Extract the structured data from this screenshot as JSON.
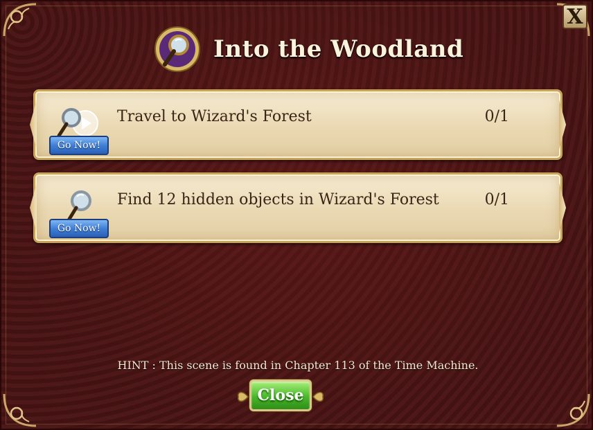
{
  "dialog": {
    "title": "Into the Woodland",
    "close_x_label": "X"
  },
  "tasks": [
    {
      "label": "Travel to Wizard's Forest",
      "progress": "0/1",
      "button_label": "Go Now!",
      "icon": "magnifier-play-icon"
    },
    {
      "label": "Find 12 hidden objects in Wizard's Forest",
      "progress": "0/1",
      "button_label": "Go Now!",
      "icon": "magnifier-icon"
    }
  ],
  "hint": "HINT : This scene is found in Chapter 113 of the Time Machine.",
  "footer": {
    "close_label": "Close"
  },
  "colors": {
    "background": "#4a1414",
    "panel": "#ead8b2",
    "gold": "#c8a45a",
    "go_button": "#3f7fd6",
    "close_button": "#48b82a"
  }
}
